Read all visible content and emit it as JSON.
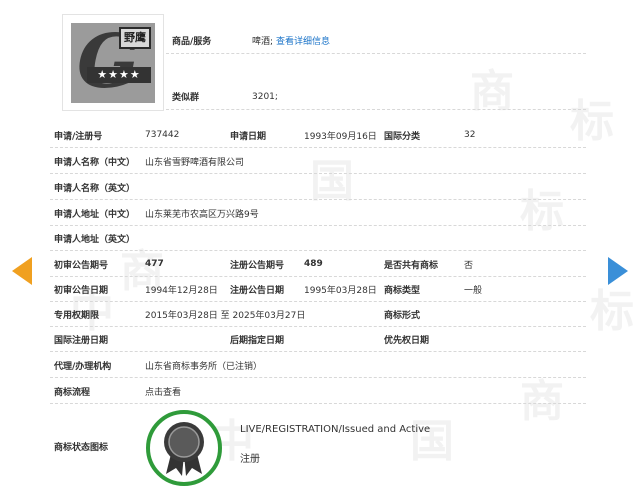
{
  "watermark": {
    "zhong": "中",
    "guo": "国",
    "shang": "商",
    "biao": "标"
  },
  "logo": {
    "mark_text": "野鹰",
    "stars": "★★★★"
  },
  "goods": {
    "label": "商品/服务",
    "value": "啤酒;",
    "link": "查看详细信息"
  },
  "similar": {
    "label": "类似群",
    "value": "3201;"
  },
  "rows": {
    "reg": {
      "l1": "申请/注册号",
      "v1": "737442",
      "l2": "申请日期",
      "v2": "1993年09月16日",
      "l3": "国际分类",
      "v3": "32"
    },
    "applicant_cn": {
      "l1": "申请人名称（中文）",
      "v1": "山东省雪野啤酒有限公司"
    },
    "applicant_en": {
      "l1": "申请人名称（英文）"
    },
    "address_cn": {
      "l1": "申请人地址（中文）",
      "v1": "山东莱芜市农高区万兴路9号"
    },
    "address_en": {
      "l1": "申请人地址（英文）"
    },
    "prelim": {
      "l1": "初审公告期号",
      "v1": "477",
      "l2": "注册公告期号",
      "v2": "489",
      "l3": "是否共有商标",
      "v3": "否"
    },
    "prelim_date": {
      "l1": "初审公告日期",
      "v1": "1994年12月28日",
      "l2": "注册公告日期",
      "v2": "1995年03月28日",
      "l3": "商标类型",
      "v3": "一般"
    },
    "exclusive": {
      "l1": "专用权期限",
      "v1": "2015年03月28日 至 2025年03月27日",
      "l3": "商标形式"
    },
    "intl": {
      "l1": "国际注册日期",
      "l2": "后期指定日期",
      "l3": "优先权日期"
    },
    "agent": {
      "l1": "代理/办理机构",
      "v1": "山东省商标事务所（已注销）"
    },
    "process": {
      "l1": "商标流程",
      "v1": "点击查看"
    }
  },
  "status": {
    "label": "商标状态图标",
    "en": "LIVE/REGISTRATION/Issued and Active",
    "cn": "注册"
  },
  "colors": {
    "accent_link": "#1a73c8",
    "arrow_left": "#f0a020",
    "arrow_right": "#3a8fd8",
    "seal_green": "#2f9b3a"
  }
}
